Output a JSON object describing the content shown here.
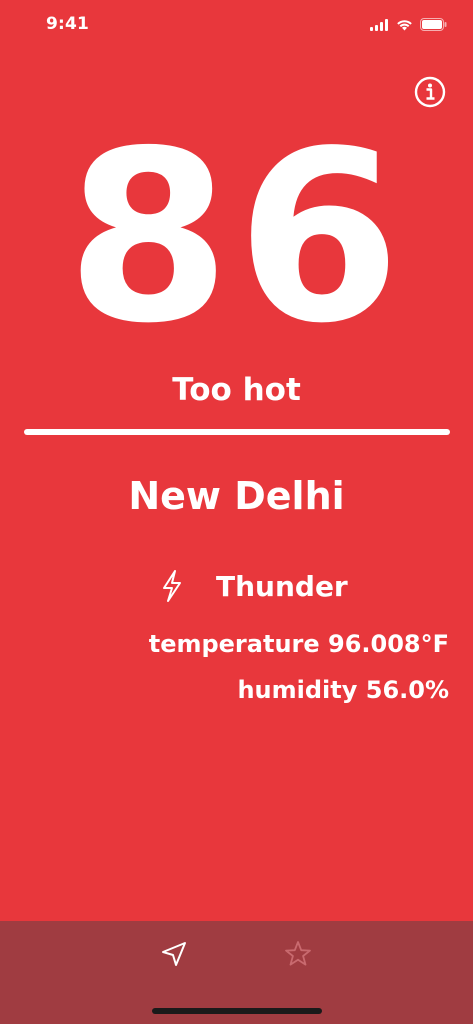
{
  "status_bar": {
    "time": "9:41"
  },
  "colors": {
    "background": "#E8373C",
    "tab_bar": "#A03C41",
    "foreground": "#FFFFFF",
    "inactive_icon": "#C96A6F"
  },
  "main": {
    "score": "86",
    "verdict": "Too hot",
    "city": "New Delhi",
    "condition": {
      "icon": "lightning-icon",
      "label": "Thunder"
    },
    "temperature_text": "temperature 96.008°F",
    "humidity_text": "humidity 56.0%"
  },
  "header": {
    "info_icon": "info-icon"
  },
  "tab_bar": {
    "tabs": [
      {
        "icon": "location-arrow-icon",
        "active": true
      },
      {
        "icon": "star-icon",
        "active": false
      }
    ]
  }
}
